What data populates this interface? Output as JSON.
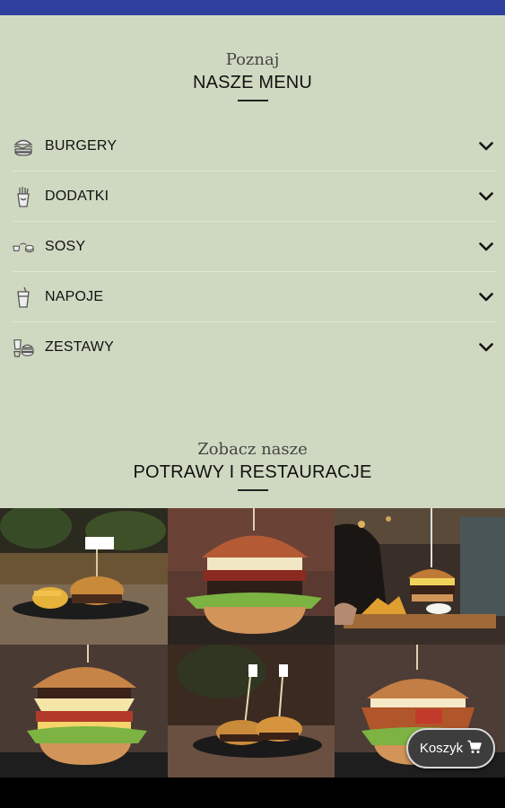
{
  "menu_section": {
    "kicker": "Poznaj",
    "heading": "NASZE MENU"
  },
  "menu_items": [
    {
      "label": "BURGERY",
      "icon": "burger-icon"
    },
    {
      "label": "DODATKI",
      "icon": "fries-icon"
    },
    {
      "label": "SOSY",
      "icon": "sauce-icon"
    },
    {
      "label": "NAPOJE",
      "icon": "drink-icon"
    },
    {
      "label": "ZESTAWY",
      "icon": "combo-icon"
    }
  ],
  "gallery_section": {
    "kicker": "Zobacz nasze",
    "heading": "POTRAWY I RESTAURACJE"
  },
  "cart": {
    "label": "Koszyk",
    "icon": "cart-icon"
  },
  "colors": {
    "status_bar": "#2f3f9e",
    "page_background": "#cfd9c1",
    "cart_button": "#3d3d3d"
  }
}
